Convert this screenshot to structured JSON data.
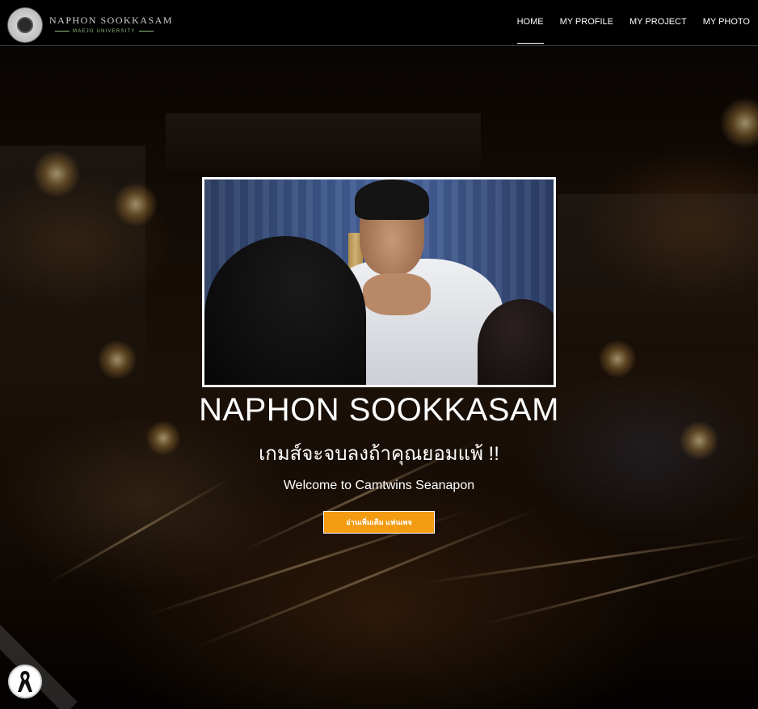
{
  "header": {
    "brand_title": "NAPHON SOOKKASAM",
    "brand_subtitle": "MAEJO UNIVERSITY",
    "logo_icon": "camera-aperture-icon",
    "nav": [
      {
        "label": "HOME",
        "active": true
      },
      {
        "label": "MY PROFILE",
        "active": false
      },
      {
        "label": "MY PROJECT",
        "active": false
      },
      {
        "label": "MY PHOTO",
        "active": false
      }
    ]
  },
  "hero": {
    "name": "NAPHON SOOKKASAM",
    "tagline_thai": "เกมส์จะจบลงถ้าคุณยอมแพ้ !!",
    "welcome": "Welcome to Camtwins Seanapon",
    "button_label": "อ่านเพิ่มเติม แฟนเพจ",
    "button_color": "#f39c12"
  },
  "corner_badge": {
    "icon": "black-ribbon-icon"
  }
}
